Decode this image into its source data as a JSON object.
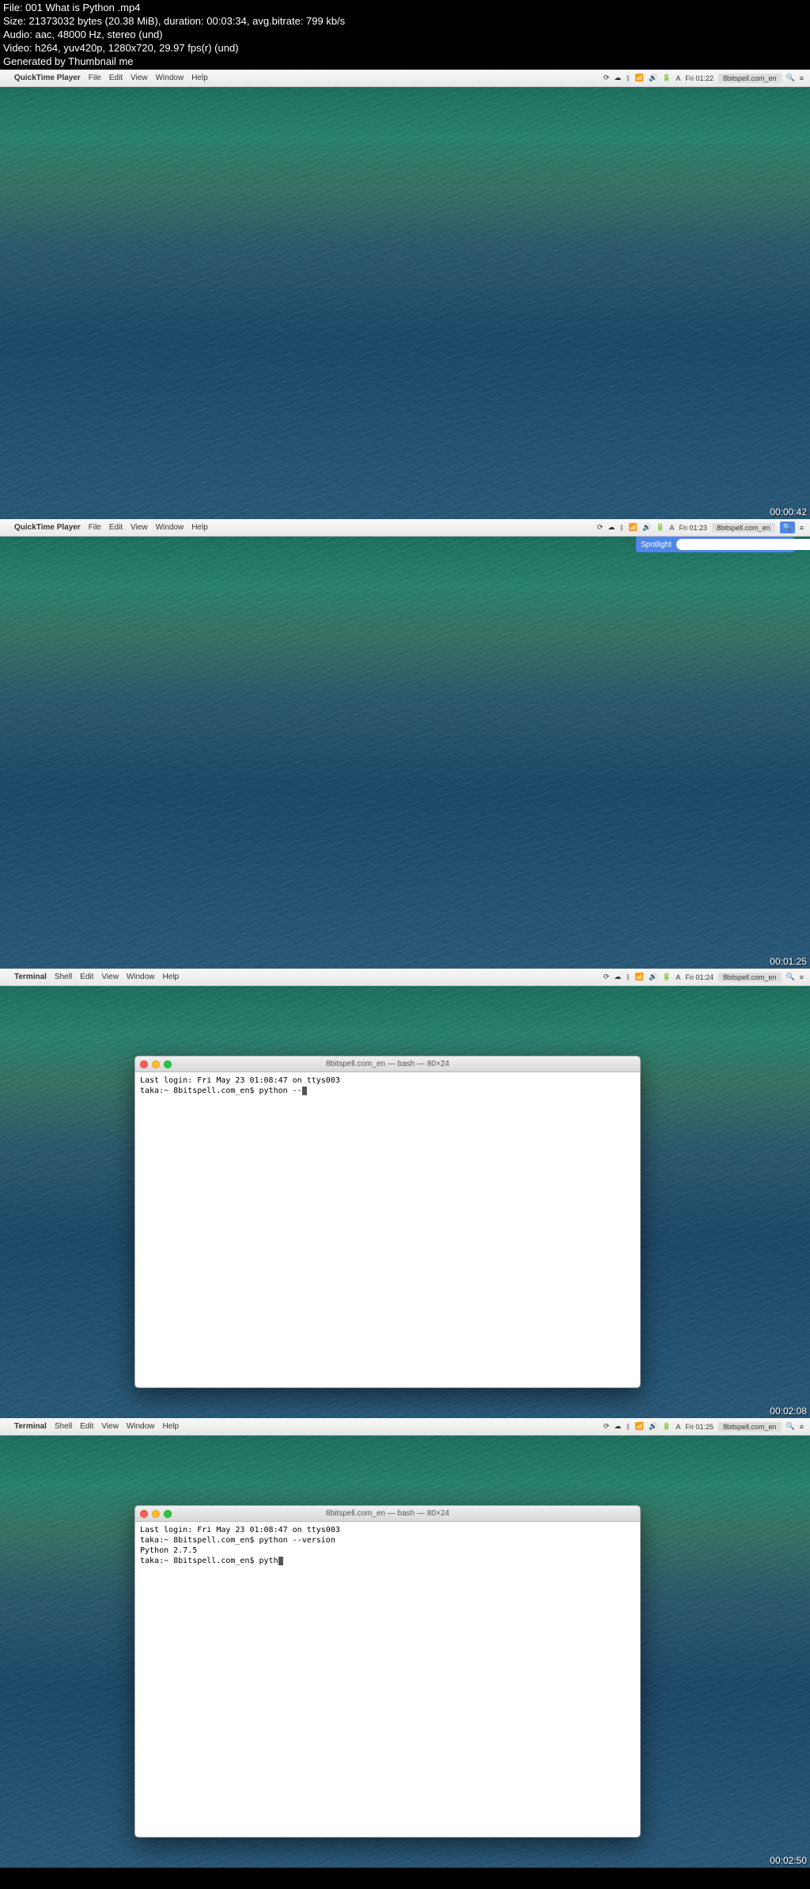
{
  "header": {
    "line1": "File: 001 What is Python .mp4",
    "line2": "Size: 21373032 bytes (20.38 MiB), duration: 00:03:34, avg.bitrate: 799 kb/s",
    "line3": "Audio: aac, 48000 Hz, stereo (und)",
    "line4": "Video: h264, yuv420p, 1280x720, 29.97 fps(r) (und)",
    "line5": "Generated by Thumbnail me"
  },
  "frames": [
    {
      "timestamp": "00:00:42",
      "menubar": {
        "app": "QuickTime Player",
        "menus": [
          "File",
          "Edit",
          "View",
          "Window",
          "Help"
        ],
        "time": "Fri 01:22",
        "status": "8bitspell.com_en"
      }
    },
    {
      "timestamp": "00:01:25",
      "menubar": {
        "app": "QuickTime Player",
        "menus": [
          "File",
          "Edit",
          "View",
          "Window",
          "Help"
        ],
        "time": "Fri 01:23",
        "status": "8bitspell.com_en"
      },
      "spotlight": {
        "label": "Spotlight",
        "value": ""
      }
    },
    {
      "timestamp": "00:02:08",
      "menubar": {
        "app": "Terminal",
        "menus": [
          "Shell",
          "Edit",
          "View",
          "Window",
          "Help"
        ],
        "time": "Fri 01:24",
        "status": "8bitspell.com_en"
      },
      "terminal": {
        "title": "8bitspell.com_en — bash — 80×24",
        "lines": [
          "Last login: Fri May 23 01:08:47 on ttys003",
          "taka:~ 8bitspell.com_en$ python --"
        ]
      }
    },
    {
      "timestamp": "00:02:50",
      "menubar": {
        "app": "Terminal",
        "menus": [
          "Shell",
          "Edit",
          "View",
          "Window",
          "Help"
        ],
        "time": "Fri 01:25",
        "status": "8bitspell.com_en"
      },
      "terminal": {
        "title": "8bitspell.com_en — bash — 80×24",
        "lines": [
          "Last login: Fri May 23 01:08:47 on ttys003",
          "taka:~ 8bitspell.com_en$ python --version",
          "Python 2.7.5",
          "taka:~ 8bitspell.com_en$ pyth"
        ]
      }
    }
  ],
  "icons": {
    "apple": "",
    "search": "🔍",
    "menu": "≡"
  }
}
